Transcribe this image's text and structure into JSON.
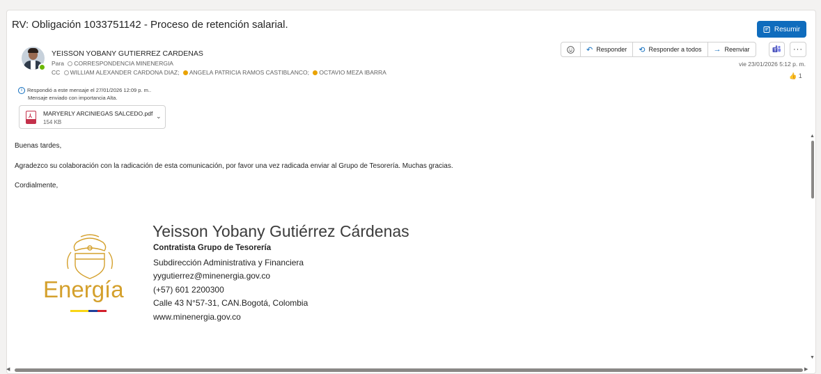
{
  "email": {
    "subject": "RV: Obligación 1033751142 - Proceso de retención salarial.",
    "summarize_label": "Resumir",
    "sender_name": "YEISSON YOBANY GUTIERREZ CARDENAS",
    "to_label": "Para",
    "to_recipient": "CORRESPONDENCIA MINENERGIA",
    "cc_label": "CC",
    "cc_recipients": [
      "WILLIAM ALEXANDER CARDONA DIAZ;",
      "ANGELA PATRICIA RAMOS CASTIBLANCO;",
      "OCTAVIO MEZA IBARRA"
    ],
    "date": "vie 23/01/2026 5:12 p. m.",
    "reaction_count": "1",
    "info_replied": "Respondió a este mensaje el 27/01/2026 12:09 p. m..",
    "info_importance": "Mensaje enviado con importancia Alta."
  },
  "actions": {
    "reply": "Responder",
    "reply_all": "Responder a todos",
    "forward": "Reenviar"
  },
  "attachment": {
    "name": "MARYERLY ARCINIEGAS SALCEDO.pdf",
    "size": "154 KB"
  },
  "body": {
    "greeting": "Buenas tardes,",
    "message": "Agradezco su colaboración con la radicación de esta comunicación, por favor una vez radicada enviar al Grupo de Tesorería. Muchas gracias.",
    "closing": "Cordialmente,"
  },
  "signature": {
    "name": "Yeisson Yobany Gutiérrez Cárdenas",
    "role": "Contratista Grupo de Tesorería",
    "department": "Subdirección Administrativa y Financiera",
    "email": "yygutierrez@minenergia.gov.co",
    "phone": "(+57) 601 2200300",
    "address": "Calle 43 N°57-31, CAN.Bogotá, Colombia",
    "website": "www.minenergia.gov.co",
    "logo_text": "Energía"
  },
  "colors": {
    "accent": "#0f6cbd",
    "logo_gold": "#d4a02c",
    "presence_green": "#6bb700",
    "flag_yellow": "#f9d616",
    "flag_blue": "#1f3f9a",
    "flag_red": "#d21f2b"
  }
}
